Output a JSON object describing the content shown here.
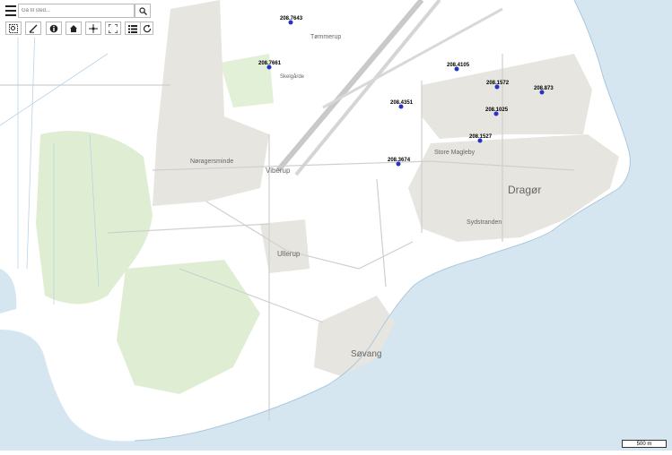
{
  "toolbar": {
    "search_placeholder": "Gå til sted...",
    "buttons": [
      "zoom-box",
      "measure",
      "info",
      "home",
      "locate",
      "fullscreen",
      "layers",
      "refresh"
    ]
  },
  "map": {
    "places": [
      {
        "name": "Tømmerup"
      },
      {
        "name": "Skelgårde"
      },
      {
        "name": "Nøragersminde"
      },
      {
        "name": "Viberup"
      },
      {
        "name": "Store Magleby"
      },
      {
        "name": "Dragør"
      },
      {
        "name": "Sydstranden"
      },
      {
        "name": "Ullerup"
      },
      {
        "name": "Søvang"
      }
    ],
    "points": [
      {
        "label": "208.7643"
      },
      {
        "label": "208.7661"
      },
      {
        "label": "208.4105"
      },
      {
        "label": "208.1572"
      },
      {
        "label": "208.873"
      },
      {
        "label": "208.4351"
      },
      {
        "label": "208.1025"
      },
      {
        "label": "208.1527"
      },
      {
        "label": "208.3674"
      }
    ],
    "colors": {
      "water": "#d6e6f1",
      "land": "#ffffff",
      "builtup": "#e6e5e0",
      "green": "#dfeed3",
      "point": "#2233cc"
    }
  },
  "scale": {
    "label": "500 m"
  }
}
